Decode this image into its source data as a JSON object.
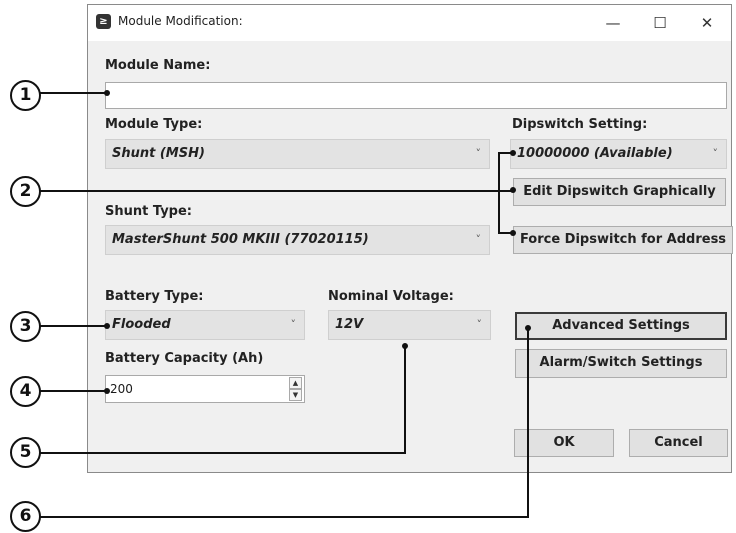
{
  "window": {
    "title": "Module Modification:",
    "minimize": "—",
    "maximize": "☐",
    "close": "✕"
  },
  "module_name": {
    "label": "Module Name:",
    "value": ""
  },
  "module_type": {
    "label": "Module Type:",
    "value": "Shunt (MSH)"
  },
  "dipswitch": {
    "label": "Dipswitch Setting:",
    "value": "10000000 (Available)",
    "edit_button": "Edit Dipswitch Graphically",
    "force_button": "Force Dipswitch for Address"
  },
  "shunt_type": {
    "label": "Shunt Type:",
    "value": "MasterShunt 500 MKIII (77020115)"
  },
  "battery_type": {
    "label": "Battery Type:",
    "value": "Flooded"
  },
  "nominal_voltage": {
    "label": "Nominal Voltage:",
    "value": "12V"
  },
  "battery_capacity": {
    "label": "Battery Capacity (Ah)",
    "value": "200"
  },
  "buttons": {
    "advanced": "Advanced Settings",
    "alarm": "Alarm/Switch Settings",
    "ok": "OK",
    "cancel": "Cancel"
  },
  "callouts": [
    "1",
    "2",
    "3",
    "4",
    "5",
    "6"
  ],
  "icons": {
    "chevron": "˅",
    "spin_up": "▲",
    "spin_down": "▼"
  }
}
